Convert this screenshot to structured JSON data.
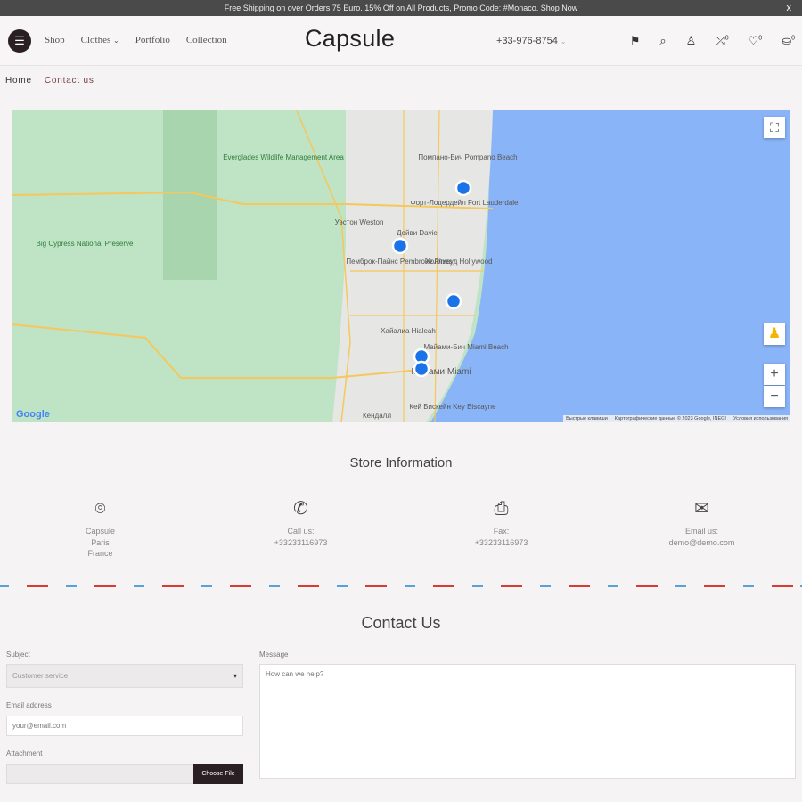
{
  "announcement": {
    "text": "Free Shipping on over Orders 75 Euro. 15% Off on All Products, Promo Code: #Monaco. Shop Now",
    "close": "x"
  },
  "header": {
    "logo": "Capsule",
    "nav": [
      "Shop",
      "Clothes",
      "Portfolio",
      "Collection"
    ],
    "phone": "+33-976-8754",
    "compare_count": "0",
    "wishlist_count": "0",
    "cart_count": "0"
  },
  "breadcrumb": [
    "Home",
    "Contact us"
  ],
  "map": {
    "labels": [
      "Форт-Лодердейл Fort Lauderdale",
      "Помпано-Бич Pompano Beach",
      "Холливуд Hollywood",
      "Хайалиа Hialeah",
      "Майами Miami",
      "Майами-Бич Miami Beach",
      "Дейви Davie",
      "Пемброк-Пайнс Pembroke Pines",
      "Уэстон Weston",
      "Big Cypress National Preserve",
      "Everglades Wildlife Management Area",
      "Кендалл",
      "Кей Бискейн Key Biscayne"
    ],
    "markers": 5,
    "attribution": [
      "Быстрые клавиши",
      "Картографические данные © 2023 Google, INEGI",
      "Условия использования"
    ],
    "logo": "Google",
    "colors": {
      "land": "#bfe3c5",
      "park": "#a8d5ad",
      "water": "#8ab4f8",
      "urban": "#e8e8e8",
      "road": "#f6c75a",
      "marker": "#1a73e8"
    }
  },
  "store": {
    "title": "Store Information",
    "items": [
      {
        "icon": "map-pin-icon",
        "lines": [
          "Capsule",
          "Paris",
          "France"
        ]
      },
      {
        "icon": "phone-icon",
        "lines": [
          "Call us:",
          "+33233116973"
        ]
      },
      {
        "icon": "printer-icon",
        "lines": [
          "Fax:",
          "+33233116973"
        ]
      },
      {
        "icon": "envelope-icon",
        "lines": [
          "Email us:",
          "demo@demo.com"
        ]
      }
    ]
  },
  "contact": {
    "title": "Contact Us",
    "subject_label": "Subject",
    "subject_value": "Customer service",
    "email_label": "Email address",
    "email_placeholder": "your@email.com",
    "attachment_label": "Attachment",
    "choose_file": "Choose File",
    "message_label": "Message",
    "message_placeholder": "How can we help?"
  }
}
